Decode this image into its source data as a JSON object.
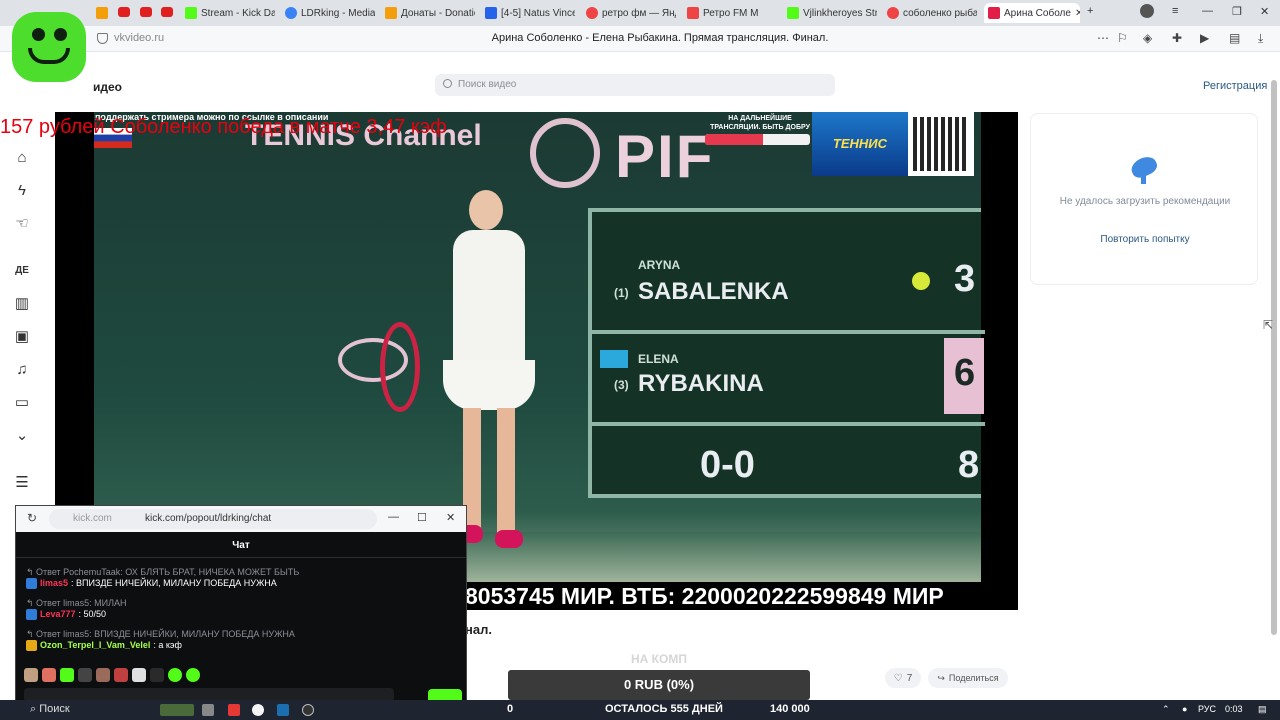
{
  "browser": {
    "tabs": [
      {
        "label": "Stream - Kick Das",
        "color": "#53fc18"
      },
      {
        "label": "LDRking - Media",
        "color": "#3b82f6"
      },
      {
        "label": "Донаты - Donatio",
        "color": "#f59e0b"
      },
      {
        "label": "[4-5] Natus Vince",
        "color": "#2563eb"
      },
      {
        "label": "ретро фм — Янд",
        "color": "#ef4444"
      },
      {
        "label": "Ретро FM M",
        "color": "#ef4444"
      },
      {
        "label": "Vjlinkheroyes Stre",
        "color": "#53fc18"
      },
      {
        "label": "соболенко рыба",
        "color": "#ef4444"
      },
      {
        "label": "Арина Соболе",
        "color": "#e11d48"
      }
    ],
    "url": "vkvideo.ru",
    "page_title": "Арина Соболенко - Елена Рыбакина. Прямая трансляция. Финал."
  },
  "site": {
    "logo": "идео",
    "search_placeholder": "Поиск видео",
    "register": "Регистрация"
  },
  "video": {
    "top_text": "поддержать стримера можно по ссылке в описании",
    "donation_goal": "НА ДАЛЬНЕЙШИЕ ТРАНСЛЯЦИИ. БЫТЬ ДОБРУ",
    "donation_fraction": 0.55,
    "tennis_channel": "TENNIS Channel",
    "pif": "PIF",
    "tennis_logo": "ТЕННИС",
    "scoreboard": {
      "p1_first": "ARYNA",
      "p1_seed": "(1)",
      "p1_last": "SABALENKA",
      "p1_score": "3",
      "p2_first": "ELENA",
      "p2_seed": "(3)",
      "p2_last": "RYBAKINA",
      "p2_score": "6",
      "points": "0-0",
      "game": "8"
    },
    "ticker": "8053745 МИР. ВТБ: 2200020222599849 МИР"
  },
  "overlay_red_text": "157 рублей Соболенко победа в матче 3,47 кэф",
  "recommendations": {
    "error": "Не удалось загрузить рекомендации",
    "retry": "Повторить попытку"
  },
  "below_video": {
    "title_fragment": "нал.",
    "likes": "7",
    "share": "Поделиться",
    "na_komp": "НА КОМП",
    "rub": "0 RUB (0%)"
  },
  "chat": {
    "domain": "kick.com",
    "path": "kick.com/popout/ldrking/chat",
    "title": "Чат",
    "messages": [
      {
        "reply": "Ответ PochemuTaak: ОХ БЛЯТЬ БРАТ, НИЧЕКА МОЖЕТ БЫТЬ",
        "user": "limas5",
        "user_color": "#ff3355",
        "text": ": ВПИЗДЕ НИЧЕЙКИ, МИЛАНУ ПОБЕДА НУЖНА"
      },
      {
        "reply": "Ответ limas5: МИЛАН",
        "user": "Leva777",
        "user_color": "#ff3355",
        "text": ": 50/50"
      },
      {
        "reply": "Ответ limas5: ВПИЗДЕ НИЧЕЙКИ, МИЛАНУ ПОБЕДА НУЖНА",
        "user": "Ozon_Terpel_I_Vam_Velel",
        "user_color": "#a6ff4a",
        "text": ": а кэф"
      }
    ]
  },
  "taskbar": {
    "search": "Поиск",
    "left_count": "0",
    "remaining": "ОСТАЛОСЬ 555 ДНЕЙ",
    "goal": "140 000",
    "lang": "РУС",
    "time": "0:03"
  }
}
